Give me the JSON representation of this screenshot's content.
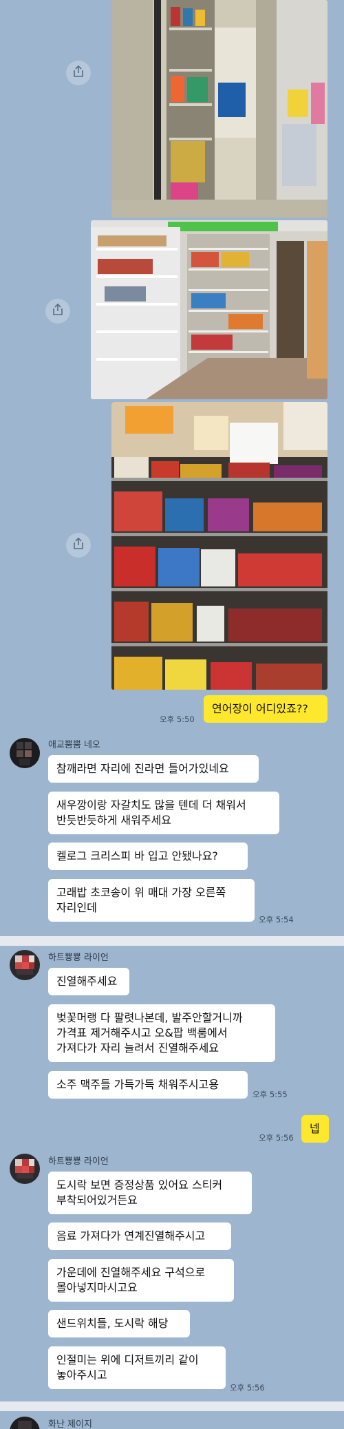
{
  "colors": {
    "background": "#9db5cf",
    "bubble_in": "#ffffff",
    "bubble_out": "#fde82e",
    "divider": "#e6e9ee"
  },
  "icons": {
    "share": "share-icon"
  },
  "messages": {
    "m1_time": "오후 5:50",
    "m1_text": "연어장이 어디있죠??",
    "g1_sender": "애교뿜뿜 네오",
    "g1_b1": "참깨라면 자리에 진라면 들어가있네요",
    "g1_b2": "새우깡이랑 자갈치도 많을 텐데 더 채워서\n반듯반듯하게 새워주세요",
    "g1_b3": "켈로그 크리스피 바 입고 안됐나요?",
    "g1_b4": "고래밥 초코송이 위 매대 가장 오른쪽\n자리인데",
    "g1_time": "오후 5:54",
    "g2_sender": "하트뿅뿅 라이언",
    "g2_b1": "진열해주세요",
    "g2_b2": "벚꽃머랭 다 팔렷나본데, 발주안할거니까\n가격표 제거해주시고 오&팝 백룸에서\n가져다가 자리 늘려서 진열해주세요",
    "g2_b3": "소주 맥주들 가득가득 채워주시고용",
    "g2_time": "오후 5:55",
    "m2_time": "오후 5:56",
    "m2_text": "넵",
    "g3_sender": "하트뿅뿅 라이언",
    "g3_b1": "도시락 보면 증정상품 있어요 스티커\n부착되어있거든요",
    "g3_b2": "음료 가져다가 연계진열해주시고",
    "g3_b3": "가운데에 진열해주세요 구석으로\n몰아넣지마시고요",
    "g3_b4": "샌드위치들, 도시락 해당",
    "g3_b5": "인절미는 위에 디저트끼리 같이\n놓아주시고",
    "g3_time": "오후 5:56",
    "g4_sender": "화난 제이지"
  }
}
